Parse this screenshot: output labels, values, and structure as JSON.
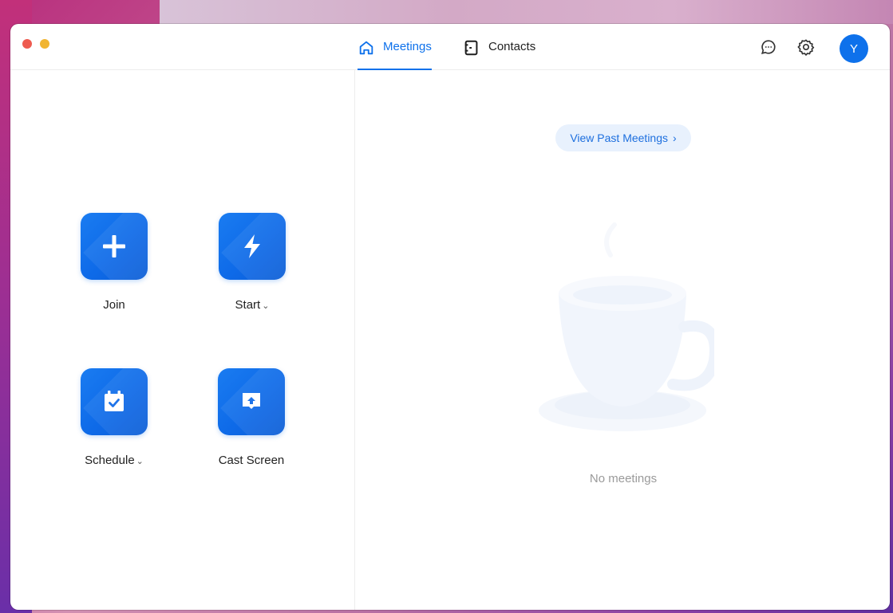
{
  "window": {
    "tabs": [
      {
        "label": "Meetings",
        "icon": "home-icon",
        "active": true
      },
      {
        "label": "Contacts",
        "icon": "contacts-icon",
        "active": false
      }
    ],
    "avatar_initial": "Y"
  },
  "actions": [
    {
      "label": "Join",
      "icon": "plus-icon",
      "has_dropdown": false
    },
    {
      "label": "Start",
      "icon": "lightning-icon",
      "has_dropdown": true
    },
    {
      "label": "Schedule",
      "icon": "calendar-icon",
      "has_dropdown": true
    },
    {
      "label": "Cast Screen",
      "icon": "share-screen-icon",
      "has_dropdown": false
    }
  ],
  "meetings_panel": {
    "past_button_label": "View Past Meetings",
    "empty_text": "No meetings"
  },
  "colors": {
    "accent": "#0e71eb",
    "close": "#ee5b50",
    "minimize": "#f1b531"
  }
}
